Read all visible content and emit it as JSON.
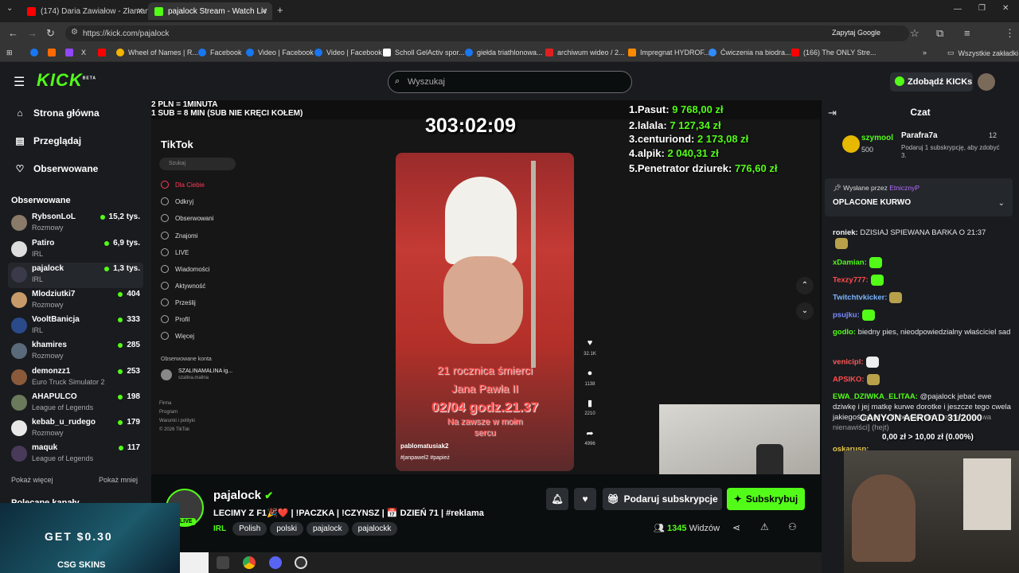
{
  "browser": {
    "tabs": [
      {
        "title": "(174) Daria Zawiałow - Złamane",
        "active": false
      },
      {
        "title": "pajalock Stream - Watch Liv",
        "active": true
      }
    ],
    "url": "https://kick.com/pajalock",
    "search_engine_chip": "Zapytaj Google",
    "bookmarks": [
      "Wheel of Names | R...",
      "Facebook",
      "Video | Facebook",
      "Video | Facebook",
      "Scholl GelActiv spor...",
      "giełda triathlonowa...",
      "archiwum wideo / 2...",
      "Impregnat HYDROF...",
      "Ćwiczenia na biodra...",
      "(166) The ONLY Stre..."
    ],
    "bookmarks_folder": "Wszystkie zakładki"
  },
  "kick": {
    "logo": "KICK",
    "logo_badge": "BETA",
    "search_placeholder": "Wyszukaj",
    "get_kicks": "Zdobądź KICKs",
    "nav": {
      "home": "Strona główna",
      "browse": "Przeglądaj",
      "following": "Obserwowane"
    },
    "followed_header": "Obserwowane",
    "followed": [
      {
        "name": "RybsonLoL",
        "category": "Rozmowy",
        "viewers": "15,2 tys."
      },
      {
        "name": "Patiro",
        "category": "IRL",
        "viewers": "6,9 tys."
      },
      {
        "name": "pajalock",
        "category": "IRL",
        "viewers": "1,3 tys."
      },
      {
        "name": "Mlodziutki7",
        "category": "Rozmowy",
        "viewers": "404"
      },
      {
        "name": "VooltBanicja",
        "category": "IRL",
        "viewers": "333"
      },
      {
        "name": "khamires",
        "category": "Rozmowy",
        "viewers": "285"
      },
      {
        "name": "demonzz1",
        "category": "Euro Truck Simulator 2",
        "viewers": "253"
      },
      {
        "name": "AHAPULCO",
        "category": "League of Legends",
        "viewers": "198"
      },
      {
        "name": "kebab_u_rudego",
        "category": "Rozmowy",
        "viewers": "179"
      },
      {
        "name": "maquk",
        "category": "League of Legends",
        "viewers": "117"
      }
    ],
    "show_more": "Pokaż więcej",
    "show_less": "Pokaż mniej",
    "recommended": "Polecane kanały"
  },
  "video": {
    "overlay_top_left": [
      "2 PLN = 1MINUTA",
      "1 SUB = 8 MIN (SUB NIE KRĘCI KOŁEM)"
    ],
    "timer": "303:02:09",
    "leaderboard": [
      {
        "rank": "1.",
        "name": "Pasut:",
        "amount": "9 768,00 zł"
      },
      {
        "rank": "2.",
        "name": "lalala:",
        "amount": "7 127,34 zł"
      },
      {
        "rank": "3.",
        "name": "centuriond:",
        "amount": "2 173,08 zł"
      },
      {
        "rank": "4.",
        "name": "alpik:",
        "amount": "2 040,31 zł"
      },
      {
        "rank": "5.",
        "name": "Penetrator dziurek:",
        "amount": "776,60 zł"
      }
    ],
    "tiktok": {
      "brand": "TikTok",
      "search": "Szukaj",
      "menu": [
        "Dla Ciebie",
        "Odkryj",
        "Obserwowani",
        "Znajomi",
        "LIVE",
        "Wiadomości",
        "Aktywność",
        "Prześlij",
        "Profil",
        "Więcej"
      ],
      "followed_accounts": "Obserwowane konta",
      "account_name": "SZALINAMALINA ig...",
      "account_handle": "szalina.malina",
      "footer": [
        "Firma",
        "Program",
        "Warunki i polityki",
        "© 2026 TikTok"
      ],
      "video_text": [
        "21 rocznica śmierci",
        "Jana Pawła II",
        "02/04 godz.21.37",
        "Na zawsze w moim",
        "sercu"
      ],
      "author": "pablomatusiak2",
      "hashtags": "#janpawel2 #papież",
      "counts": [
        "32.1K",
        "1138",
        "2210",
        "4996"
      ]
    },
    "canyon_text": "CANYON AEROAD 31/2000",
    "canyon_amount": "0,00 zł > 10,00 zł (0.00%)"
  },
  "stream": {
    "channel": "pajalock",
    "live_badge": "LIVE",
    "title": "LECIMY Z F1🎉❤️ | !PACZKA | !CZYNSZ | 📅 DZIEŃ 71 | #reklama",
    "category": "IRL",
    "tags": [
      "Polish",
      "polski",
      "pajalock",
      "pajalockk"
    ],
    "gift_subs": "Podaruj subskrypcje",
    "subscribe": "Subskrybuj",
    "viewers_count": "1345",
    "viewers_label": "Widzów"
  },
  "chat": {
    "title": "Czat",
    "gifter_1": {
      "name": "szymool",
      "count": "500"
    },
    "gifter_2": {
      "name": "Parafra7a",
      "count": "12",
      "note": "Podaruj 1 subskrypcję, aby zdobyć 3."
    },
    "pinned": {
      "by_label": "Wysłane przez",
      "by_user": "EtnicznyP",
      "message": "OPLACONE KURWO"
    },
    "messages": [
      {
        "user": "roniek:",
        "text": "DZISIAJ SPIEWANA BARKA O 21:37",
        "color": "#f0f0f0"
      },
      {
        "user": "xDamian:",
        "text": "",
        "color": "#53fc18"
      },
      {
        "user": "Texzy777:",
        "text": "",
        "color": "#ff4d4d"
      },
      {
        "user": "Twitchtvkicker:",
        "text": "",
        "color": "#7bb4ff"
      },
      {
        "user": "psujku:",
        "text": "",
        "color": "#7b8cff"
      },
      {
        "user": "godlo:",
        "text": "biedny pies, nieodpowiedzialny właściciel sad",
        "color": "#53fc18"
      },
      {
        "user": "venicipl:",
        "text": "",
        "color": "#ff5a5a"
      },
      {
        "user": "APSIKO:",
        "text": "",
        "color": "#ff4d4d"
      },
      {
        "user": "EWA_DZIWKA_ELITAA:",
        "text": "@pajalock jebać ewe dziwkę i jej matkę kurwe dorotke i jeszcze tego cwela jakiegoś jebac w dupę chamie",
        "color": "#53fc18"
      },
      {
        "user": "oskarusp:",
        "text": "",
        "color": "#e6c84a"
      }
    ],
    "deleted_note": "(Deleted)",
    "mod_note": "[mowa nienawiści] (hejt)"
  },
  "ad": {
    "text": "GET $0.30",
    "brand": "CSG SKINS"
  },
  "colors": {
    "accent": "#53fc18",
    "panel": "#191b1f",
    "bg": "#0b0e0f"
  }
}
